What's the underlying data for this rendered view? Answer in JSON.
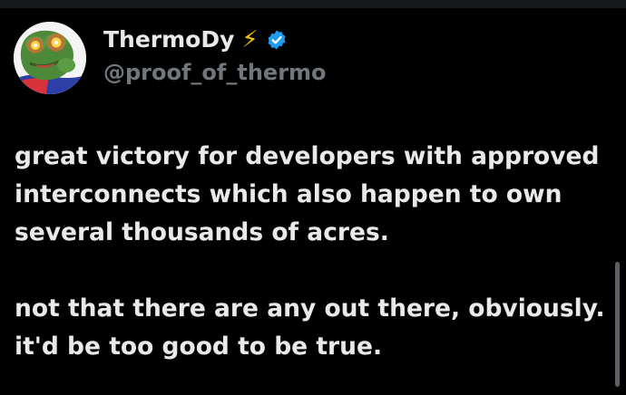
{
  "author": {
    "display_name": "ThermoDy",
    "name_emoji": "⚡",
    "handle": "@proof_of_thermo",
    "verified": true,
    "avatar_icon": "pepe-laser-eyes-avatar"
  },
  "tweet": {
    "paragraphs": [
      "great victory for developers with approved interconnects which also happen to own several thousands of acres.",
      "not that there are any out there, obviously. it'd be too good to be true."
    ]
  },
  "colors": {
    "background": "#000000",
    "text": "#e7e9ea",
    "muted": "#71767b",
    "verified": "#1d9bf0",
    "bolt": "#f7c600"
  }
}
